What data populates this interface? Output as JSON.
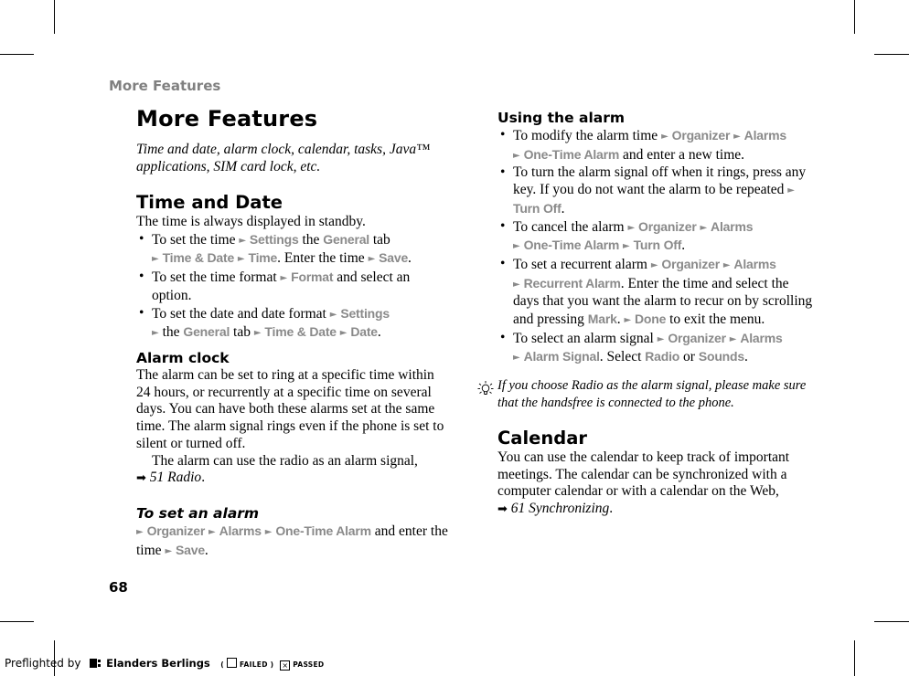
{
  "running_head": "More Features",
  "chapter": {
    "title": "More Features",
    "intro": "Time and date, alarm clock, calendar, tasks, Java™ applications, SIM card lock, etc."
  },
  "time_and_date": {
    "heading": "Time and Date",
    "lead": "The time is always displayed in standby.",
    "b1": {
      "t1": "To set the time ",
      "m1": "Settings",
      "t2": " the ",
      "m2": "General",
      "t3": " tab ",
      "m3": "Time & Date",
      "m4": "Time",
      "t4": ". Enter the time ",
      "m5": "Save",
      "t5": "."
    },
    "b2": {
      "t1": "To set the time format ",
      "m1": "Format",
      "t2": " and select an option."
    },
    "b3": {
      "t1": "To set the date and date format ",
      "m1": "Settings",
      "t2": " the ",
      "m2": "General",
      "t3": " tab ",
      "m3": "Time & Date",
      "m4": "Date",
      "t4": "."
    }
  },
  "alarm_clock": {
    "heading": "Alarm clock",
    "body": "The alarm can be set to ring at a specific time within 24 hours, or recurrently at a specific time on several days. You can have both these alarms set at the same time. The alarm signal rings even if the phone is set to silent or turned off.",
    "radio_note": "The alarm can use the radio as an alarm signal,",
    "radio_ref": "51 Radio",
    "set_heading": "To set an alarm",
    "set": {
      "m1": "Organizer",
      "m2": "Alarms",
      "m3": "One-Time Alarm",
      "t1": " and enter the time ",
      "m4": "Save",
      "t2": "."
    }
  },
  "using_alarm": {
    "heading": "Using the alarm",
    "b1": {
      "t1": "To modify the alarm time ",
      "m1": "Organizer",
      "m2": "Alarms",
      "m3": "One-Time Alarm",
      "t2": " and enter a new time."
    },
    "b2": {
      "t1": "To turn the alarm signal off when it rings, press any key. If you do not want the alarm to be repeated ",
      "m1": "Turn Off",
      "t2": "."
    },
    "b3": {
      "t1": "To cancel the alarm ",
      "m1": "Organizer",
      "m2": "Alarms",
      "m3": "One-Time Alarm",
      "m4": "Turn Off",
      "t2": "."
    },
    "b4": {
      "t1": "To set a recurrent alarm ",
      "m1": "Organizer",
      "m2": "Alarms",
      "m3": "Recurrent Alarm",
      "t2": ". Enter the time and select the days that you want the alarm to recur on by scrolling and pressing ",
      "m4": "Mark",
      "t3": ". ",
      "m5": "Done",
      "t4": " to exit the menu."
    },
    "b5": {
      "t1": "To select an alarm signal ",
      "m1": "Organizer",
      "m2": "Alarms",
      "m3": "Alarm Signal",
      "t2": ". Select ",
      "m4": "Radio",
      "t3": " or ",
      "m5": "Sounds",
      "t4": "."
    }
  },
  "tip": "If you choose Radio as the alarm signal, please make sure that the handsfree is connected to the phone.",
  "calendar": {
    "heading": "Calendar",
    "body": "You can use the calendar to keep track of important meetings. The calendar can be synchronized with a computer calendar or with a calendar on the Web,",
    "ref": "61 Synchronizing"
  },
  "page_number": "68",
  "preflight": {
    "prefix": "Preflighted by",
    "brand": "Elanders Berlings",
    "failed": "FAILED",
    "passed": "PASSED",
    "failed_checked": false,
    "passed_checked": true
  },
  "menu_arrow": "►",
  "ref_arrow": "➡"
}
